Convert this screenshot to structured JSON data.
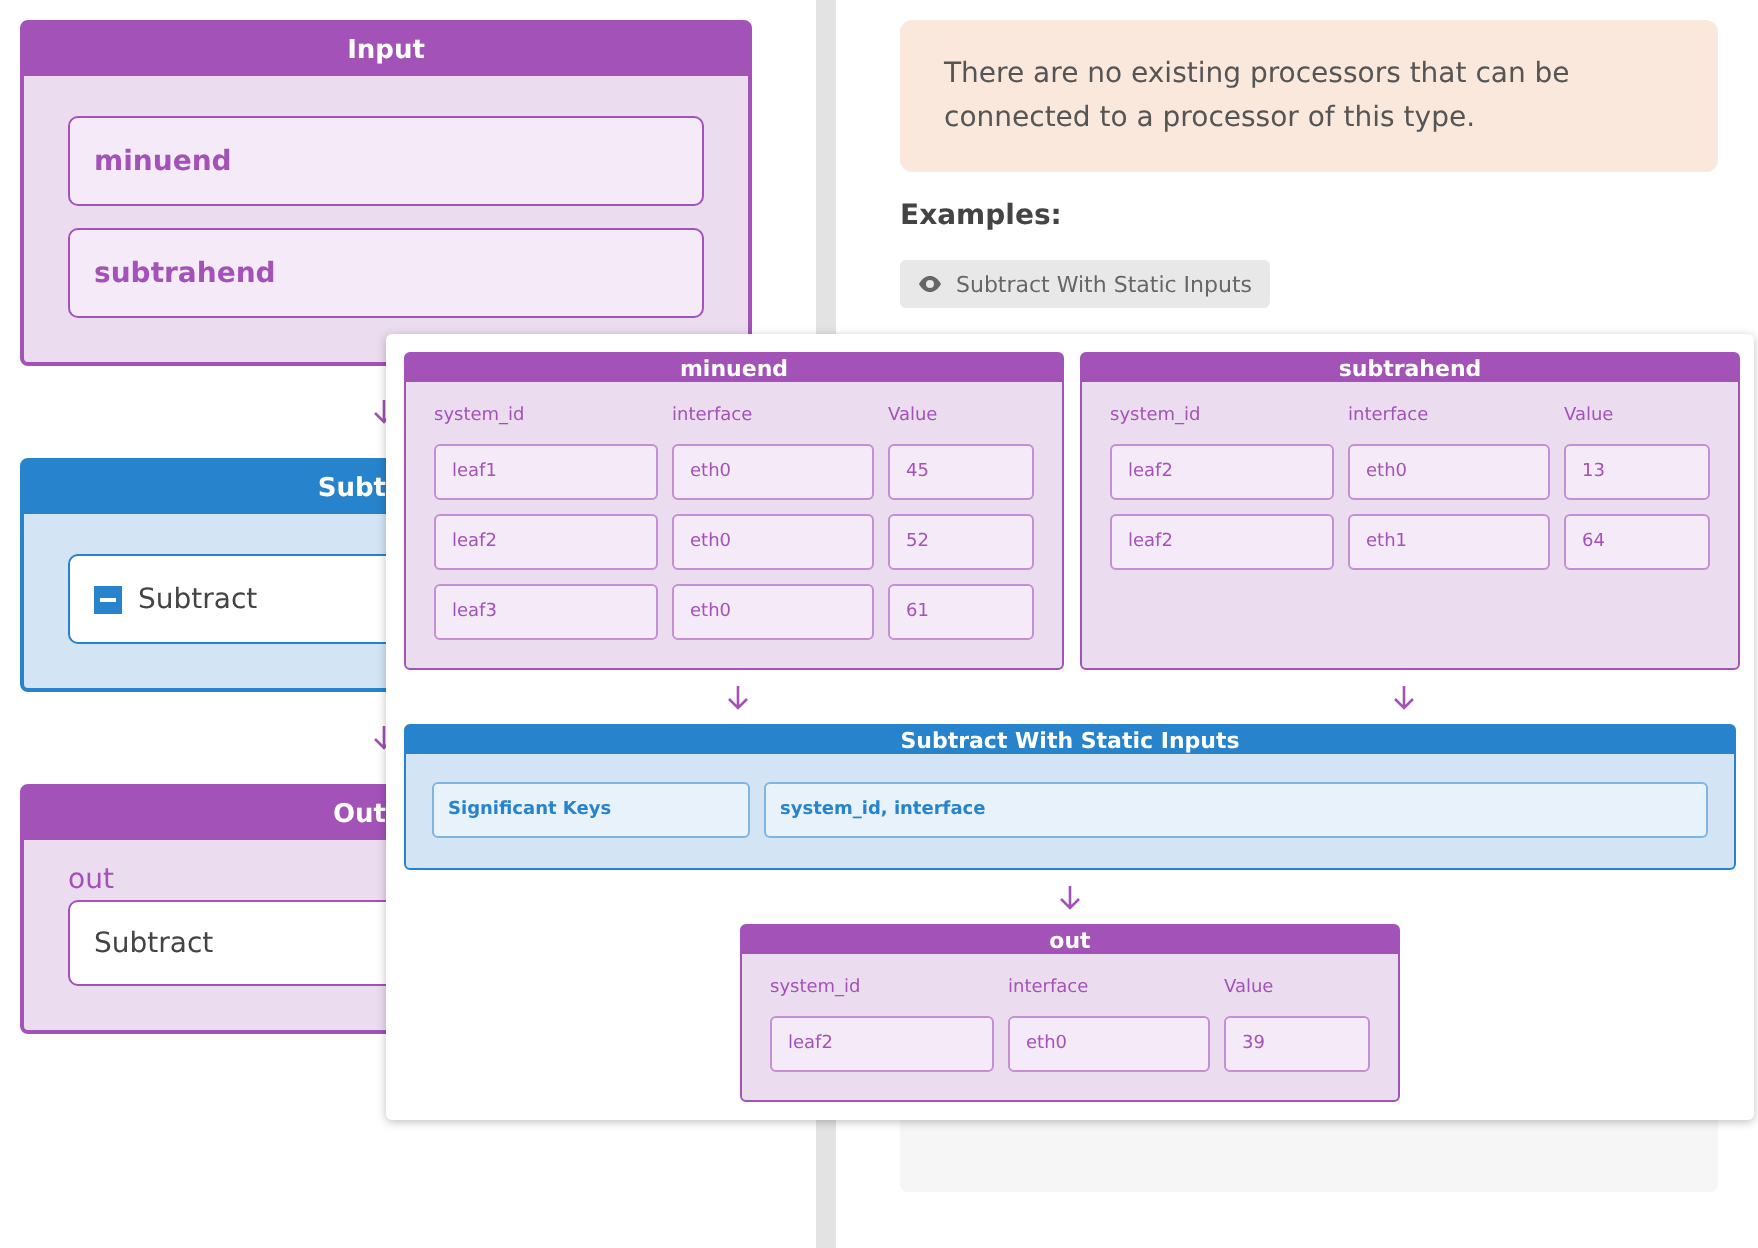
{
  "left": {
    "input": {
      "title": "Input",
      "fields": [
        "minuend",
        "subtrahend"
      ]
    },
    "processor": {
      "title": "Subt",
      "item": "Subtract"
    },
    "output": {
      "title": "Out",
      "label": "out",
      "value": "Subtract"
    }
  },
  "notice": "There are no existing processors that can be connected to a processor of this type.",
  "examples_heading": "Examples:",
  "example_button": "Subtract With Static Inputs",
  "preview": {
    "inputs": [
      {
        "title": "minuend",
        "columns": [
          "system_id",
          "interface",
          "Value"
        ],
        "rows": [
          [
            "leaf1",
            "eth0",
            "45"
          ],
          [
            "leaf2",
            "eth0",
            "52"
          ],
          [
            "leaf3",
            "eth0",
            "61"
          ]
        ]
      },
      {
        "title": "subtrahend",
        "columns": [
          "system_id",
          "interface",
          "Value"
        ],
        "rows": [
          [
            "leaf2",
            "eth0",
            "13"
          ],
          [
            "leaf2",
            "eth1",
            "64"
          ]
        ]
      }
    ],
    "processor": {
      "title": "Subtract With Static Inputs",
      "key_label": "Significant Keys",
      "key_value": "system_id, interface"
    },
    "output": {
      "title": "out",
      "columns": [
        "system_id",
        "interface",
        "Value"
      ],
      "rows": [
        [
          "leaf2",
          "eth0",
          "39"
        ]
      ]
    }
  }
}
